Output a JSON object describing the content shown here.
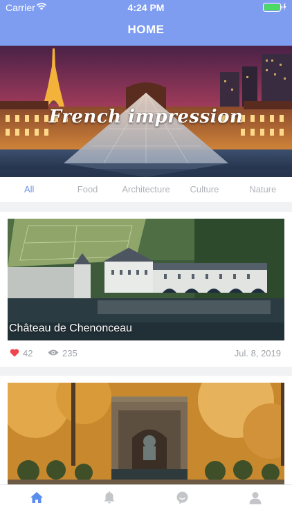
{
  "status_bar": {
    "carrier": "Carrier",
    "time": "4:24 PM"
  },
  "nav": {
    "title": "HOME",
    "background": "#7e9df1"
  },
  "hero": {
    "title": "French impression"
  },
  "categories": {
    "active_color": "#6e93ec",
    "items": [
      {
        "label": "All",
        "active": true
      },
      {
        "label": "Food",
        "active": false
      },
      {
        "label": "Architecture",
        "active": false
      },
      {
        "label": "Culture",
        "active": false
      },
      {
        "label": "Nature",
        "active": false
      }
    ]
  },
  "posts": [
    {
      "title": "Château de Chenonceau",
      "likes": "42",
      "views": "235",
      "date": "Jul. 8, 2019"
    },
    {
      "title": "",
      "likes": "",
      "views": "",
      "date": ""
    }
  ],
  "tab_bar": {
    "items": [
      {
        "icon": "home-icon",
        "active": true
      },
      {
        "icon": "bell-icon",
        "active": false
      },
      {
        "icon": "chat-bubble-icon",
        "active": false
      },
      {
        "icon": "person-icon",
        "active": false
      }
    ],
    "active_color": "#5b8def",
    "inactive_color": "#c3c5c9"
  }
}
